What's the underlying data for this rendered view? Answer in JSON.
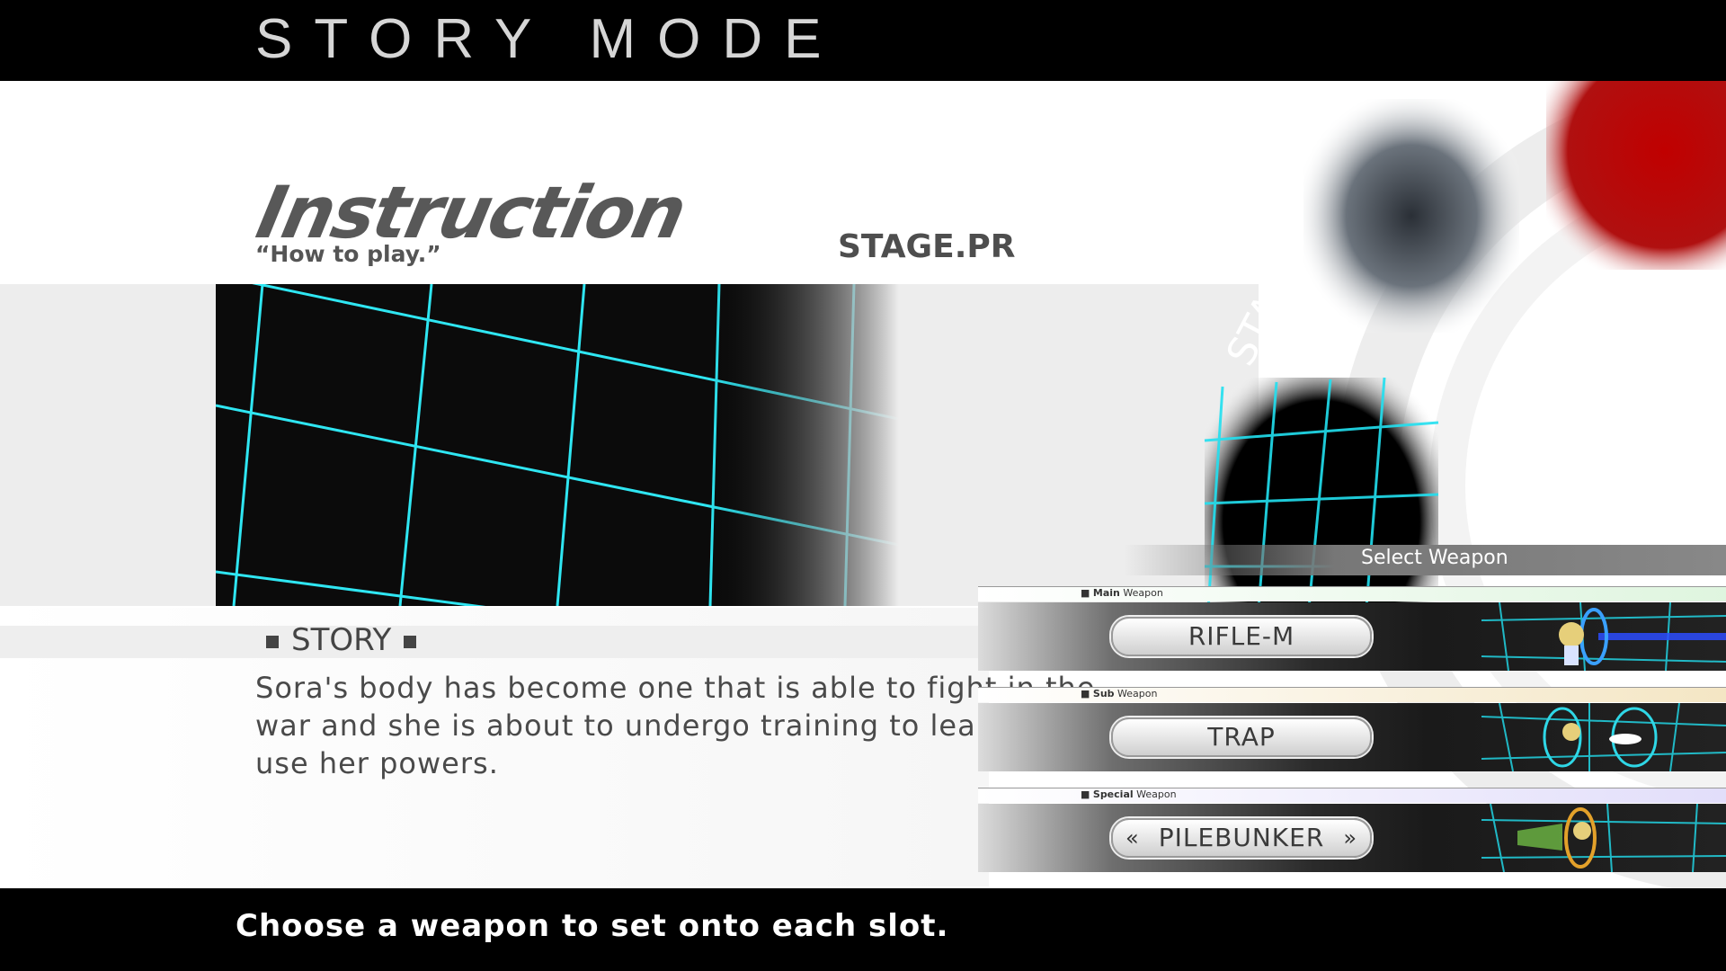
{
  "header": {
    "mode_title": "STORY MODE"
  },
  "stage": {
    "title": "Instruction",
    "subtitle": "“How to play.”",
    "code": "STAGE.PR"
  },
  "story": {
    "heading": "STORY",
    "text": "Sora's body has become one that is able to fight in the war and she is about to undergo training to learn how to use her powers."
  },
  "deco": {
    "stage_text": "STAGE"
  },
  "weapon_select": {
    "label": "Select Weapon",
    "slots": [
      {
        "type_word": "Main",
        "suffix": "Weapon",
        "value": "RIFLE-M",
        "accent": "#dff5df"
      },
      {
        "type_word": "Sub",
        "suffix": "Weapon",
        "value": "TRAP",
        "accent": "#f4e6c4"
      },
      {
        "type_word": "Special",
        "suffix": "Weapon",
        "value": "PILEBUNKER",
        "accent": "#e2defa"
      }
    ]
  },
  "footer": {
    "hint": "Choose a weapon to set onto each slot."
  },
  "colors": {
    "grid_cyan": "#22e0f0",
    "bar_black": "#000000"
  }
}
